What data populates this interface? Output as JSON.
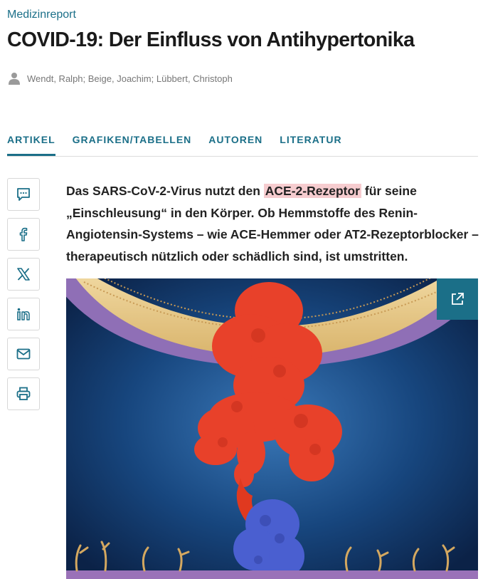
{
  "article": {
    "kicker": "Medizinreport",
    "title": "COVID-19: Der Einfluss von Antihypertonika",
    "authors": "Wendt, Ralph; Beige, Joachim; Lübbert, Christoph",
    "lead_before": "Das SARS-CoV-2-Virus nutzt den ",
    "lead_highlight": "ACE-2-Rezeptor",
    "lead_after": " für seine „Einschleusung“ in den Körper. Ob Hemmstoffe des Renin-Angiotensin-Systems – wie ACE-Hemmer oder AT2-Rezeptorblocker – therapeutisch nützlich oder schädlich sind, ist umstritten."
  },
  "tabs": [
    {
      "label": "ARTIKEL",
      "active": true
    },
    {
      "label": "GRAFIKEN/TABELLEN",
      "active": false
    },
    {
      "label": "AUTOREN",
      "active": false
    },
    {
      "label": "LITERATUR",
      "active": false
    }
  ],
  "share": [
    "comment-icon",
    "facebook-icon",
    "x-icon",
    "linkedin-icon",
    "mail-icon",
    "print-icon"
  ],
  "figure": {
    "icon": "external-link-icon",
    "accent_color": "#1b6f88"
  },
  "colors": {
    "accent": "#1b6f88",
    "highlight": "#f6cccf"
  }
}
